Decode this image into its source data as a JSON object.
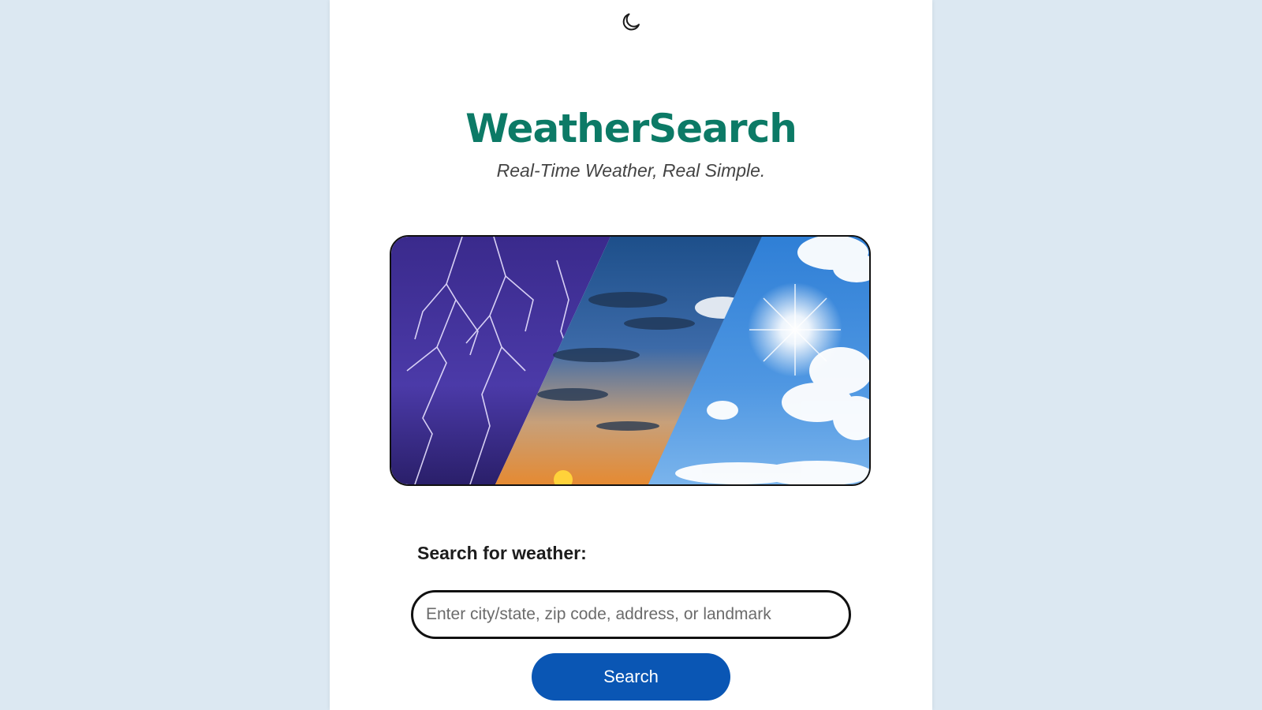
{
  "header": {
    "theme_toggle_icon": "moon-icon",
    "title": "WeatherSearch",
    "subtitle": "Real-Time Weather, Real Simple."
  },
  "hero": {
    "image_icon": "weather-collage-image",
    "panels": [
      "storm",
      "sunset",
      "clouds",
      "sunny"
    ]
  },
  "search": {
    "label": "Search for weather:",
    "placeholder": "Enter city/state, zip code, address, or landmark",
    "value": "",
    "button_label": "Search"
  },
  "colors": {
    "background": "#dce8f2",
    "title": "#0c7a66",
    "button": "#0a56b4"
  }
}
